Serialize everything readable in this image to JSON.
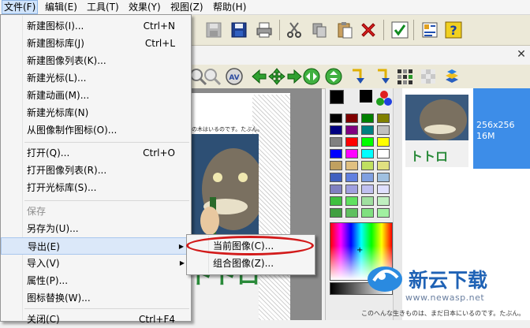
{
  "menubar": {
    "items": [
      {
        "label": "文件(F)"
      },
      {
        "label": "编辑(E)"
      },
      {
        "label": "工具(T)"
      },
      {
        "label": "效果(Y)"
      },
      {
        "label": "视图(Z)"
      },
      {
        "label": "帮助(H)"
      }
    ]
  },
  "file_menu": {
    "items": [
      {
        "label": "新建图标(I)...",
        "shortcut": "Ctrl+N"
      },
      {
        "label": "新建图标库(J)",
        "shortcut": "Ctrl+L"
      },
      {
        "label": "新建图像列表(K)..."
      },
      {
        "label": "新建光标(L)..."
      },
      {
        "label": "新建动画(M)..."
      },
      {
        "label": "新建光标库(N)"
      },
      {
        "label": "从图像制作图标(O)..."
      },
      {
        "label": "打开(Q)...",
        "shortcut": "Ctrl+O"
      },
      {
        "label": "打开图像列表(R)..."
      },
      {
        "label": "打开光标库(S)..."
      },
      {
        "label": "保存",
        "disabled": true
      },
      {
        "label": "另存为(U)..."
      },
      {
        "label": "导出(E)",
        "highlighted": true
      },
      {
        "label": "导入(V)"
      },
      {
        "label": "属性(P)..."
      },
      {
        "label": "图标替换(W)..."
      },
      {
        "label": "关闭(C)",
        "shortcut": "Ctrl+F4"
      }
    ]
  },
  "export_submenu": {
    "items": [
      {
        "label": "当前图像(C)..."
      },
      {
        "label": "组合图像(Z)..."
      }
    ]
  },
  "preview": {
    "size_label": "256x256",
    "color_label": "16M"
  },
  "canvas": {
    "poster_text": "この木はいるのです。たぶん。"
  },
  "watermark": {
    "title": "新云下载",
    "url": "www.newasp.net",
    "footer": "このへんな生きものは、まだ日本にいるのです。たぶん。"
  },
  "palette": {
    "colors": [
      "#000000",
      "#800000",
      "#008000",
      "#808000",
      "#000080",
      "#800080",
      "#008080",
      "#c0c0c0",
      "#808080",
      "#ff0000",
      "#00ff00",
      "#ffff00",
      "#0000ff",
      "#ff00ff",
      "#00ffff",
      "#ffffff",
      "#c0a060",
      "#e0c080",
      "#c0e060",
      "#e0e080",
      "#4060c0",
      "#6080e0",
      "#80a0e0",
      "#a0c0e0",
      "#8080c0",
      "#a0a0e0",
      "#c0c0f0",
      "#e0e0ff",
      "#40c040",
      "#60e060",
      "#a0e0a0",
      "#c0f0c0",
      "#40a040",
      "#60c060",
      "#80e080",
      "#a0f0a0"
    ],
    "accent": "#3d8de8"
  }
}
